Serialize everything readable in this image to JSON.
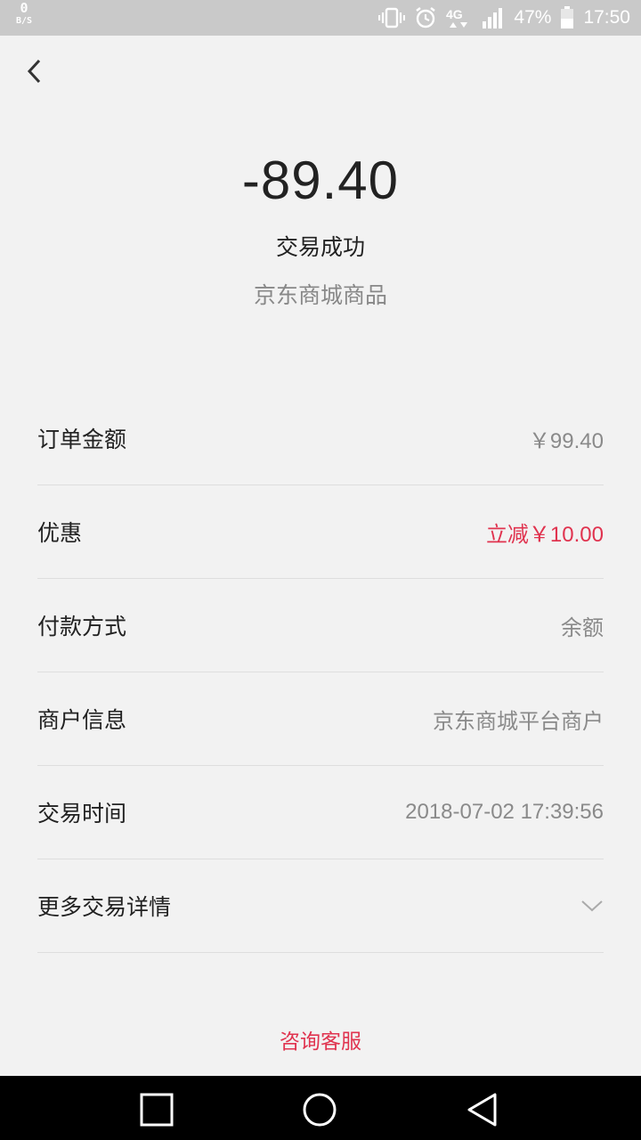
{
  "status_bar": {
    "net_speed_value": "0",
    "net_speed_unit": "B/S",
    "battery": "47%",
    "time": "17:50"
  },
  "summary": {
    "amount": "-89.40",
    "status": "交易成功",
    "merchant": "京东商城商品"
  },
  "details": {
    "rows": [
      {
        "label": "订单金额",
        "value": "￥99.40"
      },
      {
        "label": "优惠",
        "value": "立减￥10.00"
      },
      {
        "label": "付款方式",
        "value": "余额"
      },
      {
        "label": "商户信息",
        "value": "京东商城平台商户"
      },
      {
        "label": "交易时间",
        "value": "2018-07-02 17:39:56"
      },
      {
        "label": "更多交易详情",
        "value": ""
      }
    ]
  },
  "footer": {
    "consult": "咨询客服"
  },
  "colors": {
    "accent_red": "#e0334f",
    "background": "#f2f2f2",
    "status_bar": "#c9c9c9"
  },
  "icons": [
    "back-icon",
    "chevron-down-icon",
    "vibrate-icon",
    "alarm-icon",
    "signal-icon",
    "battery-icon",
    "nav-recent-icon",
    "nav-home-icon",
    "nav-back-icon"
  ]
}
